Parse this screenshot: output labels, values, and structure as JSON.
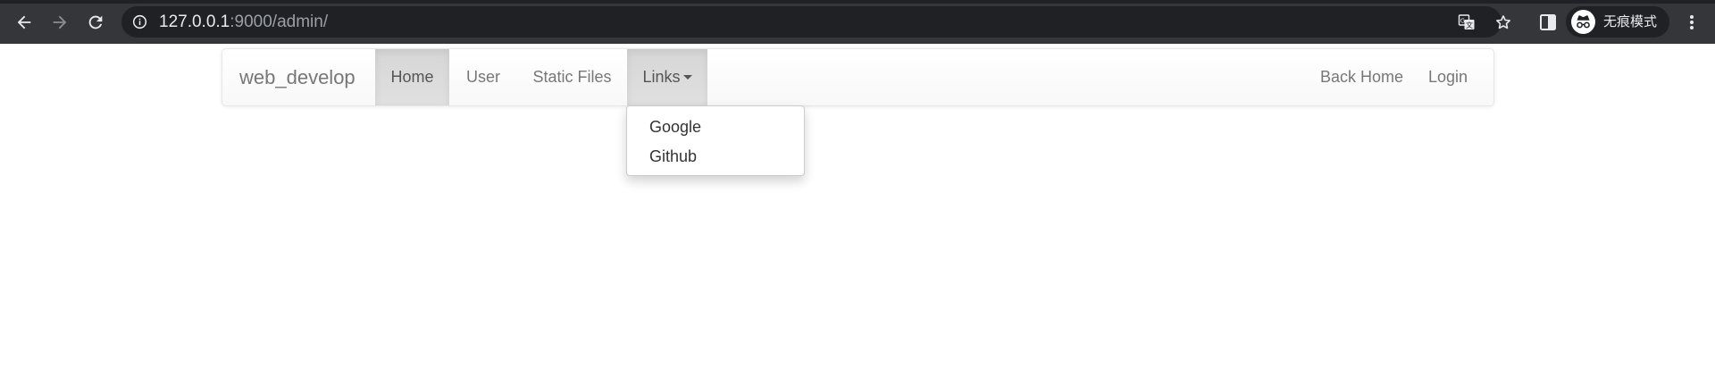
{
  "browser": {
    "url_host": "127.0.0.1",
    "url_rest": ":9000/admin/",
    "profile_label": "无痕模式",
    "icons": {
      "back": "arrow-left-icon",
      "forward": "arrow-right-icon",
      "reload": "reload-icon",
      "site_info": "info-icon",
      "translate": "translate-icon",
      "bookmark": "star-icon",
      "side_panel": "side-panel-icon",
      "incognito": "incognito-icon",
      "menu": "kebab-menu-icon"
    },
    "colors": {
      "frame": "#35363a",
      "omnibox": "#202124",
      "text": "#e8eaed",
      "muted": "#9aa0a6"
    }
  },
  "navbar": {
    "brand": "web_develop",
    "items": [
      {
        "label": "Home",
        "active": true
      },
      {
        "label": "User",
        "active": false
      },
      {
        "label": "Static Files",
        "active": false
      },
      {
        "label": "Links",
        "active": true,
        "dropdown": true
      }
    ],
    "right_items": [
      {
        "label": "Back Home"
      },
      {
        "label": "Login"
      }
    ]
  },
  "dropdown": {
    "items": [
      {
        "label": "Google"
      },
      {
        "label": "Github"
      }
    ]
  }
}
